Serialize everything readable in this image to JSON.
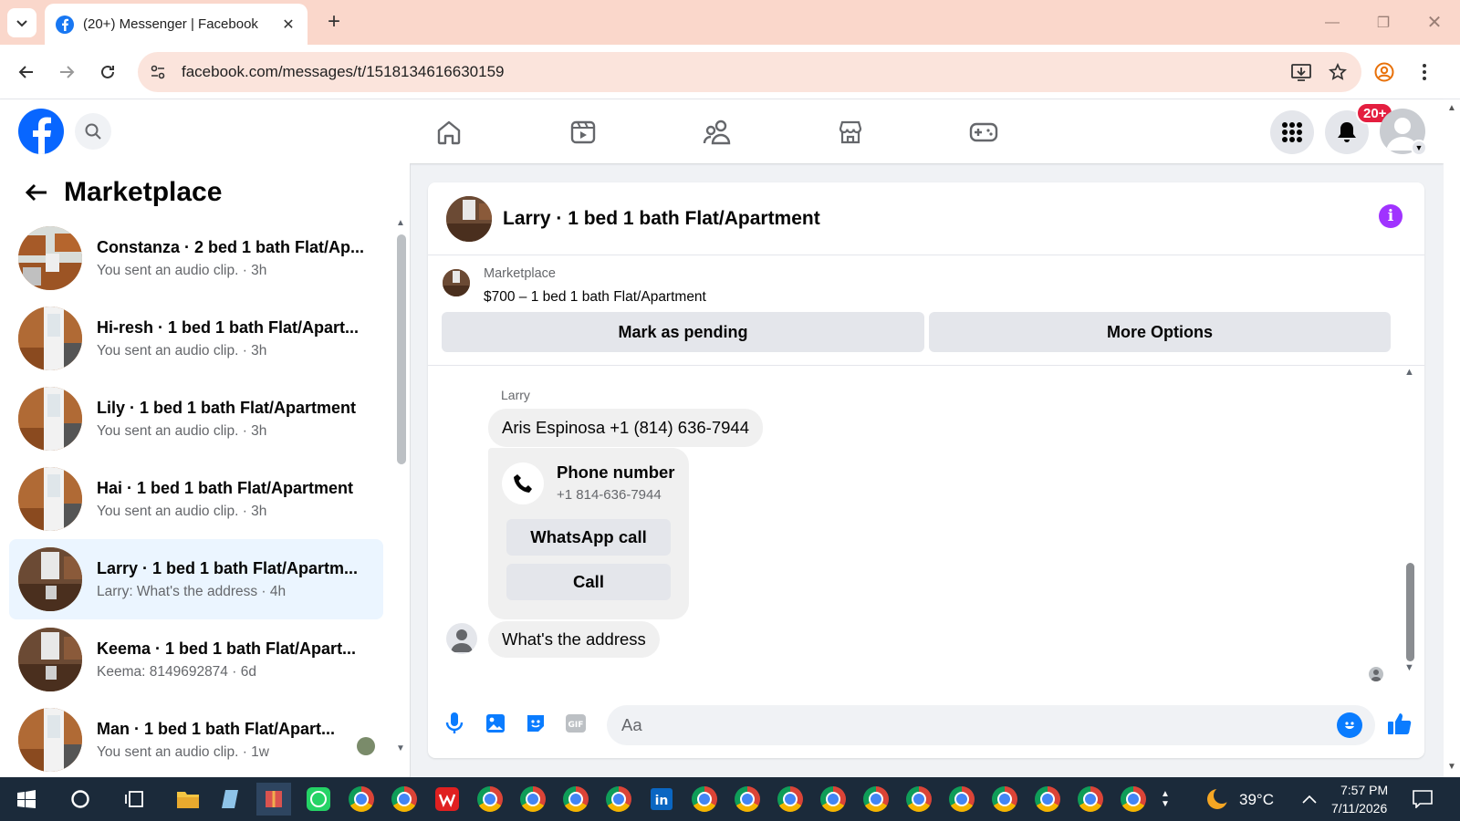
{
  "browser": {
    "tab_title": "(20+) Messenger | Facebook",
    "url": "facebook.com/messages/t/1518134616630159"
  },
  "fb_header": {
    "notification_badge": "20+"
  },
  "left_panel": {
    "title": "Marketplace",
    "conversations": [
      {
        "name": "Constanza · 2 bed 1 bath Flat/Ap...",
        "preview": "You sent an audio clip. · 3h",
        "active": false
      },
      {
        "name": "Hi-resh · 1 bed 1 bath Flat/Apart...",
        "preview": "You sent an audio clip. · 3h",
        "active": false
      },
      {
        "name": "Lily · 1 bed 1 bath Flat/Apartment",
        "preview": "You sent an audio clip. · 3h",
        "active": false
      },
      {
        "name": "Hai · 1 bed 1 bath Flat/Apartment",
        "preview": "You sent an audio clip. · 3h",
        "active": false
      },
      {
        "name": "Larry · 1 bed 1 bath Flat/Apartm...",
        "preview": "Larry: What's the address · 4h",
        "active": true
      },
      {
        "name": "Keema · 1 bed 1 bath Flat/Apart...",
        "preview": "Keema: 8149692874 · 6d",
        "active": false
      },
      {
        "name": "Man · 1 bed 1 bath Flat/Apart...",
        "preview": "You sent an audio clip. · 1w",
        "active": false
      }
    ]
  },
  "chat": {
    "header_title": "Larry · 1 bed 1 bath Flat/Apartment",
    "marketplace_label": "Marketplace",
    "listing": "$700 – 1 bed 1 bath Flat/Apartment",
    "mark_pending_label": "Mark as pending",
    "more_options_label": "More Options",
    "sender_name": "Larry",
    "messages": {
      "contact_text": "Aris Espinosa +1 (814) 636-7944",
      "last_text": "What's the address"
    },
    "phone_card": {
      "title": "Phone number",
      "number": "+1 814-636-7944",
      "whatsapp_label": "WhatsApp call",
      "call_label": "Call"
    },
    "composer_placeholder": "Aa"
  },
  "taskbar": {
    "temperature": "39°C",
    "time": "7:57 PM",
    "date": "7/11/2026"
  },
  "colors": {
    "fb_blue": "#0866ff",
    "messenger_purple": "#a033ff",
    "active_conv": "#ebf5ff",
    "tab_strip": "#fad7cb"
  }
}
